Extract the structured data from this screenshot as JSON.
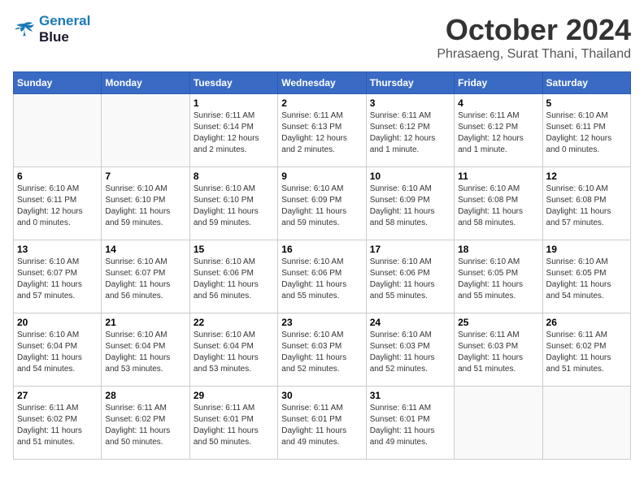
{
  "header": {
    "logo_line1": "General",
    "logo_line2": "Blue",
    "month": "October 2024",
    "location": "Phrasaeng, Surat Thani, Thailand"
  },
  "weekdays": [
    "Sunday",
    "Monday",
    "Tuesday",
    "Wednesday",
    "Thursday",
    "Friday",
    "Saturday"
  ],
  "weeks": [
    [
      {
        "day": "",
        "detail": ""
      },
      {
        "day": "",
        "detail": ""
      },
      {
        "day": "1",
        "detail": "Sunrise: 6:11 AM\nSunset: 6:14 PM\nDaylight: 12 hours\nand 2 minutes."
      },
      {
        "day": "2",
        "detail": "Sunrise: 6:11 AM\nSunset: 6:13 PM\nDaylight: 12 hours\nand 2 minutes."
      },
      {
        "day": "3",
        "detail": "Sunrise: 6:11 AM\nSunset: 6:12 PM\nDaylight: 12 hours\nand 1 minute."
      },
      {
        "day": "4",
        "detail": "Sunrise: 6:11 AM\nSunset: 6:12 PM\nDaylight: 12 hours\nand 1 minute."
      },
      {
        "day": "5",
        "detail": "Sunrise: 6:10 AM\nSunset: 6:11 PM\nDaylight: 12 hours\nand 0 minutes."
      }
    ],
    [
      {
        "day": "6",
        "detail": "Sunrise: 6:10 AM\nSunset: 6:11 PM\nDaylight: 12 hours\nand 0 minutes."
      },
      {
        "day": "7",
        "detail": "Sunrise: 6:10 AM\nSunset: 6:10 PM\nDaylight: 11 hours\nand 59 minutes."
      },
      {
        "day": "8",
        "detail": "Sunrise: 6:10 AM\nSunset: 6:10 PM\nDaylight: 11 hours\nand 59 minutes."
      },
      {
        "day": "9",
        "detail": "Sunrise: 6:10 AM\nSunset: 6:09 PM\nDaylight: 11 hours\nand 59 minutes."
      },
      {
        "day": "10",
        "detail": "Sunrise: 6:10 AM\nSunset: 6:09 PM\nDaylight: 11 hours\nand 58 minutes."
      },
      {
        "day": "11",
        "detail": "Sunrise: 6:10 AM\nSunset: 6:08 PM\nDaylight: 11 hours\nand 58 minutes."
      },
      {
        "day": "12",
        "detail": "Sunrise: 6:10 AM\nSunset: 6:08 PM\nDaylight: 11 hours\nand 57 minutes."
      }
    ],
    [
      {
        "day": "13",
        "detail": "Sunrise: 6:10 AM\nSunset: 6:07 PM\nDaylight: 11 hours\nand 57 minutes."
      },
      {
        "day": "14",
        "detail": "Sunrise: 6:10 AM\nSunset: 6:07 PM\nDaylight: 11 hours\nand 56 minutes."
      },
      {
        "day": "15",
        "detail": "Sunrise: 6:10 AM\nSunset: 6:06 PM\nDaylight: 11 hours\nand 56 minutes."
      },
      {
        "day": "16",
        "detail": "Sunrise: 6:10 AM\nSunset: 6:06 PM\nDaylight: 11 hours\nand 55 minutes."
      },
      {
        "day": "17",
        "detail": "Sunrise: 6:10 AM\nSunset: 6:06 PM\nDaylight: 11 hours\nand 55 minutes."
      },
      {
        "day": "18",
        "detail": "Sunrise: 6:10 AM\nSunset: 6:05 PM\nDaylight: 11 hours\nand 55 minutes."
      },
      {
        "day": "19",
        "detail": "Sunrise: 6:10 AM\nSunset: 6:05 PM\nDaylight: 11 hours\nand 54 minutes."
      }
    ],
    [
      {
        "day": "20",
        "detail": "Sunrise: 6:10 AM\nSunset: 6:04 PM\nDaylight: 11 hours\nand 54 minutes."
      },
      {
        "day": "21",
        "detail": "Sunrise: 6:10 AM\nSunset: 6:04 PM\nDaylight: 11 hours\nand 53 minutes."
      },
      {
        "day": "22",
        "detail": "Sunrise: 6:10 AM\nSunset: 6:04 PM\nDaylight: 11 hours\nand 53 minutes."
      },
      {
        "day": "23",
        "detail": "Sunrise: 6:10 AM\nSunset: 6:03 PM\nDaylight: 11 hours\nand 52 minutes."
      },
      {
        "day": "24",
        "detail": "Sunrise: 6:10 AM\nSunset: 6:03 PM\nDaylight: 11 hours\nand 52 minutes."
      },
      {
        "day": "25",
        "detail": "Sunrise: 6:11 AM\nSunset: 6:03 PM\nDaylight: 11 hours\nand 51 minutes."
      },
      {
        "day": "26",
        "detail": "Sunrise: 6:11 AM\nSunset: 6:02 PM\nDaylight: 11 hours\nand 51 minutes."
      }
    ],
    [
      {
        "day": "27",
        "detail": "Sunrise: 6:11 AM\nSunset: 6:02 PM\nDaylight: 11 hours\nand 51 minutes."
      },
      {
        "day": "28",
        "detail": "Sunrise: 6:11 AM\nSunset: 6:02 PM\nDaylight: 11 hours\nand 50 minutes."
      },
      {
        "day": "29",
        "detail": "Sunrise: 6:11 AM\nSunset: 6:01 PM\nDaylight: 11 hours\nand 50 minutes."
      },
      {
        "day": "30",
        "detail": "Sunrise: 6:11 AM\nSunset: 6:01 PM\nDaylight: 11 hours\nand 49 minutes."
      },
      {
        "day": "31",
        "detail": "Sunrise: 6:11 AM\nSunset: 6:01 PM\nDaylight: 11 hours\nand 49 minutes."
      },
      {
        "day": "",
        "detail": ""
      },
      {
        "day": "",
        "detail": ""
      }
    ]
  ]
}
